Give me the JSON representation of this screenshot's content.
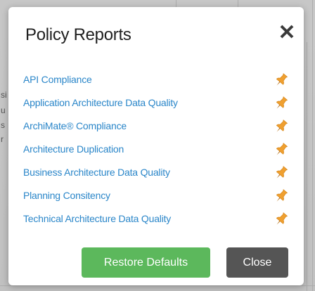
{
  "dialog": {
    "title": "Policy Reports",
    "close_icon": "close-x-icon"
  },
  "reports": [
    {
      "label": "API Compliance",
      "pin_icon": "pin-icon"
    },
    {
      "label": "Application Architecture Data Quality",
      "pin_icon": "pin-icon"
    },
    {
      "label": "ArchiMate® Compliance",
      "pin_icon": "pin-icon"
    },
    {
      "label": "Architecture Duplication",
      "pin_icon": "pin-icon"
    },
    {
      "label": "Business Architecture Data Quality",
      "pin_icon": "pin-icon"
    },
    {
      "label": "Planning Consitency",
      "pin_icon": "pin-icon"
    },
    {
      "label": "Technical Architecture Data Quality",
      "pin_icon": "pin-icon"
    }
  ],
  "footer": {
    "restore_label": "Restore Defaults",
    "close_label": "Close"
  },
  "background": {
    "fragments": [
      "si",
      "u",
      "s",
      "r"
    ]
  },
  "colors": {
    "link": "#2a86c9",
    "pin": "#f0a030",
    "restore_button": "#5cb85c",
    "close_button": "#555555"
  }
}
